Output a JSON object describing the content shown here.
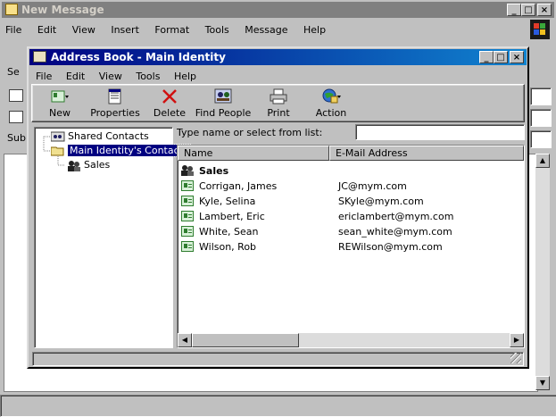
{
  "new_message": {
    "title": "New Message",
    "menu": [
      "File",
      "Edit",
      "View",
      "Insert",
      "Format",
      "Tools",
      "Message",
      "Help"
    ],
    "field_labels": [
      "Se",
      "Sub"
    ]
  },
  "address_book": {
    "title": "Address Book - Main Identity",
    "menu": [
      "File",
      "Edit",
      "View",
      "Tools",
      "Help"
    ],
    "toolbar": {
      "new": "New",
      "properties": "Properties",
      "delete": "Delete",
      "find_people": "Find People",
      "print": "Print",
      "action": "Action"
    },
    "tree": {
      "shared": "Shared Contacts",
      "main": "Main Identity's Contacts",
      "sales": "Sales"
    },
    "search": {
      "label": "Type name or select from list:",
      "value": ""
    },
    "columns": {
      "name": "Name",
      "email": "E-Mail Address"
    },
    "group_row": "Sales",
    "contacts": [
      {
        "name": "Corrigan, James",
        "email": "JC@mym.com"
      },
      {
        "name": "Kyle, Selina",
        "email": "SKyle@mym.com"
      },
      {
        "name": "Lambert, Eric",
        "email": "ericlambert@mym.com"
      },
      {
        "name": "White, Sean",
        "email": "sean_white@mym.com"
      },
      {
        "name": "Wilson, Rob",
        "email": "REWilson@mym.com"
      }
    ]
  },
  "colors": {
    "title_active_start": "#000080",
    "title_active_end": "#1084d0",
    "title_inactive": "#808080",
    "selection": "#000080",
    "face": "#c0c0c0"
  }
}
